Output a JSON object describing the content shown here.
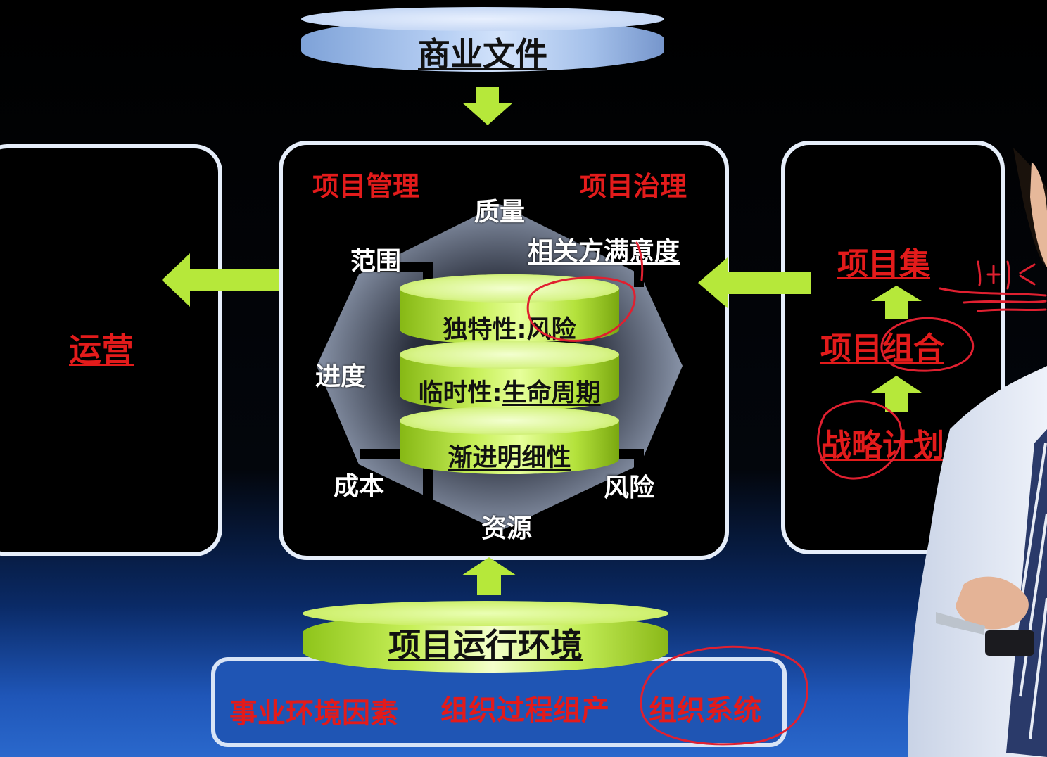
{
  "top_cylinder": {
    "label": "商业文件"
  },
  "left_panel": {
    "label": "运营"
  },
  "center_panel": {
    "top_left": "项目管理",
    "top_right": "项目治理",
    "octagon_labels": {
      "quality": "质量",
      "scope": "范围",
      "satisfaction": "相关方满意度",
      "schedule": "进度",
      "cost": "成本",
      "risk": "风险",
      "resources": "资源"
    },
    "stack": [
      {
        "label": "独特性:",
        "value": "风险"
      },
      {
        "label": "临时性:",
        "value": "生命周期"
      },
      {
        "label": "",
        "value": "渐进明细性"
      }
    ]
  },
  "right_panel": {
    "items": [
      "项目集",
      "项目组合",
      "战略计划"
    ]
  },
  "bottom_cylinder": {
    "label": "项目运行环境"
  },
  "bottom_box": {
    "items": [
      "事业环境因素",
      "组织过程组产",
      "组织系统"
    ]
  },
  "colors": {
    "accent_green": "#b6e83a",
    "label_red": "#e31b1b",
    "panel_border": "#e6eefa",
    "blue_cylinder": "#a8c4ee"
  }
}
